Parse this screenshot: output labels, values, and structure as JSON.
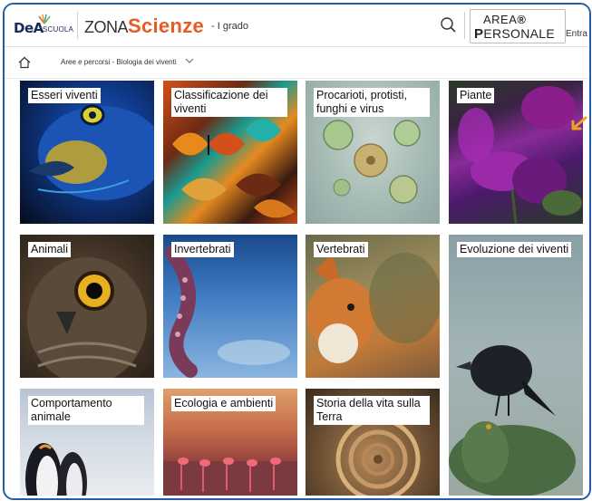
{
  "header": {
    "logo_text": "DeA",
    "logo_sub": "SCUOLA",
    "brand_zona": "ZONA",
    "brand_scienze": "Scienze",
    "brand_grado": "- I grado",
    "area_line1_a": "AREA",
    "area_line1_b": "",
    "area_line2_a": "P",
    "area_line2_b": "ERSONALE",
    "entra_label": "Entra"
  },
  "breadcrumb": {
    "text": "Aree e percorsi - Biologia dei viventi"
  },
  "tiles": [
    {
      "label": "Esseri viventi"
    },
    {
      "label": "Classificazione dei viventi"
    },
    {
      "label": "Procarioti, protisti, funghi e virus"
    },
    {
      "label": "Piante"
    },
    {
      "label": "Animali"
    },
    {
      "label": "Invertebrati"
    },
    {
      "label": "Vertebrati"
    },
    {
      "label": "Evoluzione dei viventi"
    },
    {
      "label": "Comportamento animale"
    },
    {
      "label": "Ecologia e ambienti"
    },
    {
      "label": "Storia della vita sulla Terra"
    }
  ],
  "colors": {
    "brand_orange": "#e95a24",
    "frame_blue": "#1f5fa6",
    "arrow_yellow": "#f0a020"
  }
}
